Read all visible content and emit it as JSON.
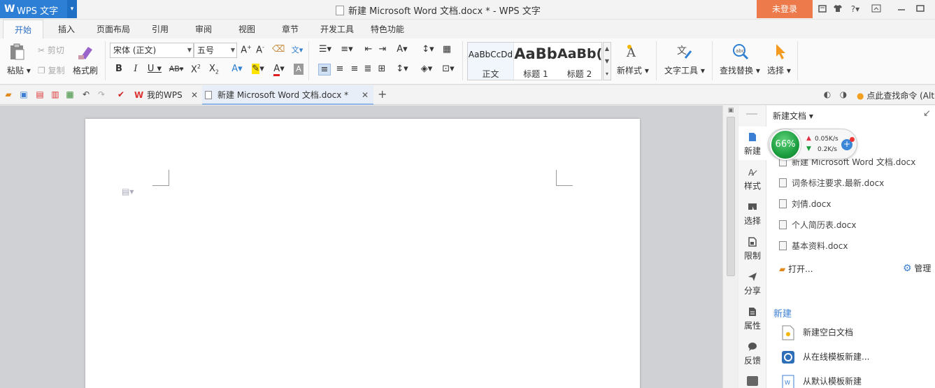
{
  "app": {
    "logo": "W",
    "name": "WPS 文字",
    "menu_arrow": "▾"
  },
  "window": {
    "title": "新建 Microsoft Word 文档.docx * - WPS 文字",
    "login": "未登录",
    "help": "?"
  },
  "ribbon_tabs": [
    "开始",
    "插入",
    "页面布局",
    "引用",
    "审阅",
    "视图",
    "章节",
    "开发工具",
    "特色功能"
  ],
  "clipboard": {
    "paste": "粘贴",
    "cut": "剪切",
    "copy": "复制",
    "format_painter": "格式刷"
  },
  "font": {
    "name": "宋体 (正文)",
    "size": "五号"
  },
  "styles": [
    {
      "preview": "AaBbCcDd",
      "name": "正文"
    },
    {
      "preview": "AaBb",
      "name": "标题 1"
    },
    {
      "preview": "AaBb(",
      "name": "标题 2"
    }
  ],
  "tools": {
    "new_style": "新样式",
    "text_tools": "文字工具",
    "find_replace": "查找替换",
    "select": "选择"
  },
  "doc_tabs": [
    {
      "label": "我的WPS"
    },
    {
      "label": "新建 Microsoft Word 文档.docx *"
    }
  ],
  "command_search": "点此查找命令 (Alt",
  "sidebar": [
    "新建",
    "样式",
    "选择",
    "限制",
    "分享",
    "属性",
    "反馈"
  ],
  "panel": {
    "header": "新建文档",
    "recent": [
      "新建 Microsoft Word 文档.docx",
      "词条标注要求.最新.docx",
      "刘倩.docx",
      "个人简历表.docx",
      "基本资料.docx"
    ],
    "open": "打开...",
    "manage": "管理",
    "new_section": "新建",
    "new_items": [
      "新建空白文档",
      "从在线模板新建...",
      "从默认模板新建"
    ]
  },
  "speed": {
    "percent": "66%",
    "up": "0.05K/s",
    "down": "0.2K/s"
  }
}
